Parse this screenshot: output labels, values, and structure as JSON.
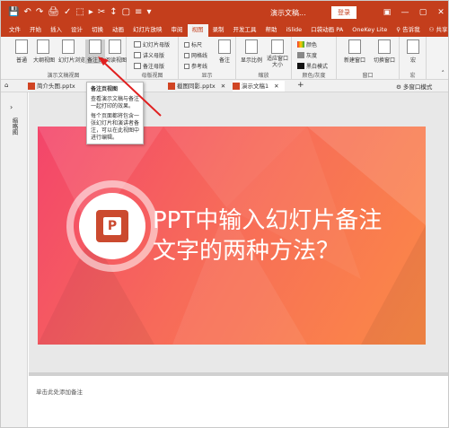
{
  "titlebar": {
    "quick_access": [
      "💾",
      "↶",
      "↷",
      "🖨",
      "✓",
      "⬚",
      "▸",
      "✂",
      "↕",
      "▢",
      "≡",
      "▾"
    ],
    "title": "演示文稿...",
    "login": "登录",
    "window_controls": [
      "▣",
      "—",
      "▢",
      "✕"
    ]
  },
  "tabs": {
    "items": [
      "文件",
      "开始",
      "插入",
      "设计",
      "切换",
      "动画",
      "幻灯片放映",
      "审阅",
      "视图",
      "录制",
      "开发工具",
      "帮助",
      "iSlide",
      "口袋动画 PA",
      "OneKey Lite"
    ],
    "active": "视图",
    "search": "告诉我",
    "share": "共享"
  },
  "ribbon": {
    "presentation_views": {
      "label": "演示文稿视图",
      "buttons": [
        "普通",
        "大纲视图",
        "幻灯片浏览",
        "备注页",
        "阅读视图"
      ]
    },
    "master_views": {
      "label": "母版视图",
      "items": [
        "幻灯片母版",
        "讲义母版",
        "备注母版"
      ]
    },
    "show": {
      "label": "显示",
      "items": [
        "标尺",
        "网格线",
        "参考线"
      ],
      "notes_button": "备注"
    },
    "zoom": {
      "label": "缩放",
      "buttons": [
        "显示比例",
        "适应窗口大小"
      ]
    },
    "color": {
      "label": "颜色/灰度",
      "items": [
        "颜色",
        "灰度",
        "黑白模式"
      ]
    },
    "window": {
      "label": "窗口",
      "buttons": [
        "新建窗口",
        "切换窗口"
      ]
    },
    "macro": {
      "label": "宏",
      "button": "宏"
    }
  },
  "doc_tabs": {
    "tabs": [
      "简介头图.pptx",
      "截图同影.pptx",
      "演示文稿1"
    ],
    "add": "+",
    "right": "多窗口模式"
  },
  "tooltip": {
    "title": "备注页视图",
    "p1": "查看演示文稿与备注一起打印的效果。",
    "p2": "每个页面都将包含一张幻灯片和演讲者备注，可以在此视图中进行编辑。"
  },
  "left_pane": {
    "collapse": "›",
    "label": "缩略图"
  },
  "slide": {
    "logo_letter": "P",
    "title_line1": "PPT中输入幻灯片备注",
    "title_line2": "文字的两种方法？"
  },
  "notes": {
    "placeholder": "单击此处添加备注"
  },
  "colors": {
    "accent": "#c43e1c",
    "slide_gradient_start": "#f3456b",
    "slide_gradient_end": "#fb8a46",
    "annotation": "#e02020"
  }
}
